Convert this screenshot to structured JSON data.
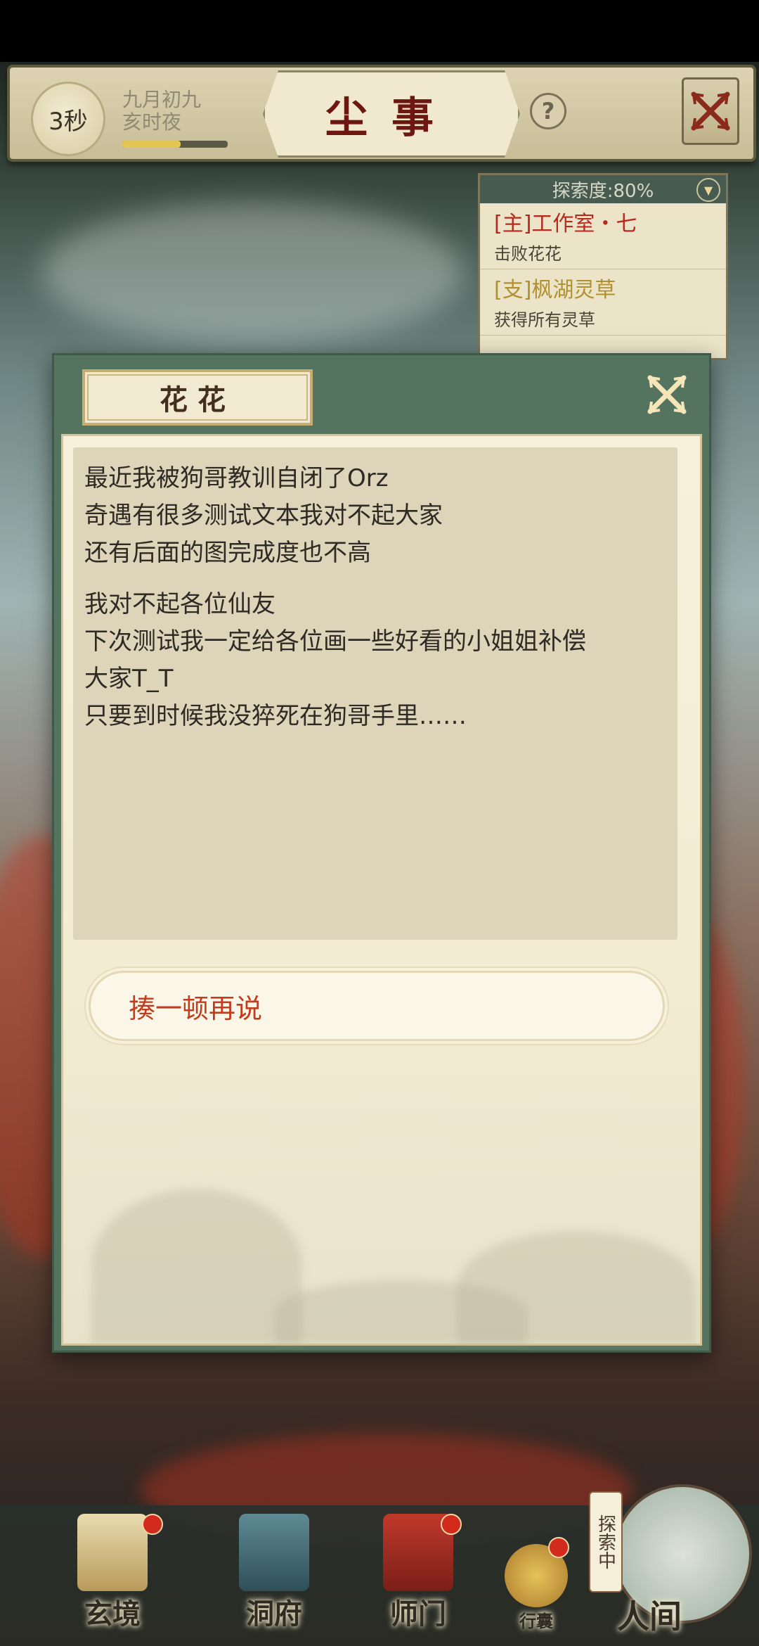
{
  "topbar": {
    "timer": "3秒",
    "date_line1": "九月初九",
    "date_line2": "亥时夜",
    "time_progress": 0.55,
    "title": "尘事",
    "help": "?"
  },
  "quest_panel": {
    "header": "探索度:80%",
    "items": [
      {
        "title": "[主]工作室・七",
        "desc": "击败花花",
        "type": "main"
      },
      {
        "title": "[支]枫湖灵草",
        "desc": "获得所有灵草",
        "type": "side"
      }
    ]
  },
  "dialog": {
    "speaker": "花花",
    "paragraphs": [
      [
        "最近我被狗哥教训自闭了Orz",
        "奇遇有很多测试文本我对不起大家",
        "还有后面的图完成度也不高"
      ],
      [
        "我对不起各位仙友",
        "下次测试我一定给各位画一些好看的小姐姐补偿",
        "大家T_T",
        "只要到时候我没猝死在狗哥手里……"
      ]
    ],
    "choice": "揍一顿再说"
  },
  "bottom_nav": {
    "items": [
      {
        "label": "玄境",
        "badge": true
      },
      {
        "label": "洞府",
        "badge": false
      },
      {
        "label": "师门",
        "badge": true
      },
      {
        "label": "行囊",
        "badge": true
      },
      {
        "label": "人间",
        "badge": false
      }
    ],
    "explore_tag": "探索中"
  },
  "colors": {
    "dialog_frame": "#55745f",
    "parchment": "#f7f1dc",
    "choice_text": "#c23c20",
    "title_text": "#6d1711"
  }
}
